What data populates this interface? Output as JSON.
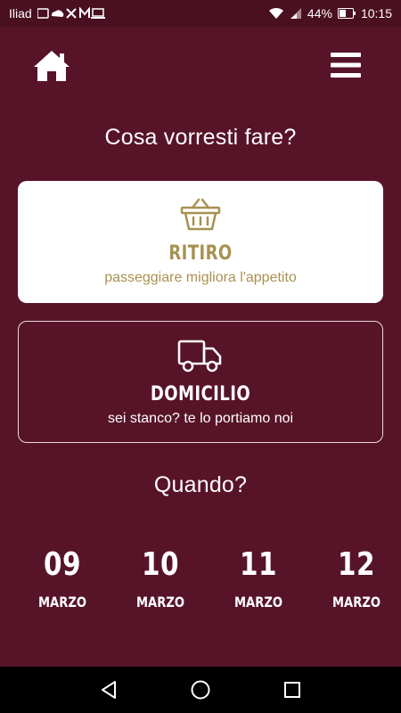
{
  "status_bar": {
    "carrier": "Iliad",
    "battery": "44%",
    "time": "10:15"
  },
  "header": {
    "home_icon": "home-icon",
    "menu_icon": "hamburger-menu-icon"
  },
  "question_service": "Cosa vorresti fare?",
  "options": [
    {
      "title": "RITIRO",
      "subtitle": "passeggiare migliora l'appetito",
      "icon": "basket-icon",
      "selected": true
    },
    {
      "title": "DOMICILIO",
      "subtitle": "sei stanco? te lo portiamo noi",
      "icon": "truck-icon",
      "selected": false
    }
  ],
  "question_when": "Quando?",
  "dates": [
    {
      "day": "09",
      "month": "MARZO"
    },
    {
      "day": "10",
      "month": "MARZO"
    },
    {
      "day": "11",
      "month": "MARZO"
    },
    {
      "day": "12",
      "month": "MARZO"
    }
  ],
  "colors": {
    "background": "#571428",
    "accent_gold": "#a89150",
    "card_white": "#ffffff"
  }
}
